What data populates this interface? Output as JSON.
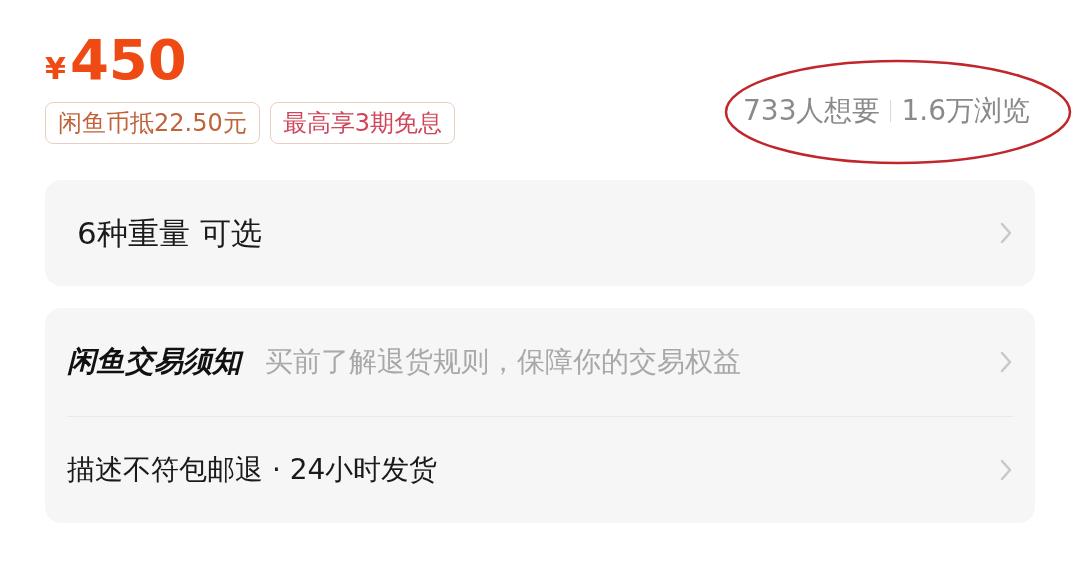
{
  "price": {
    "currency": "¥",
    "amount": "450"
  },
  "tags": [
    {
      "text": "闲鱼币抵22.50元",
      "color": "#c0623a"
    },
    {
      "text": "最高享3期免息",
      "color": "#d0455a"
    }
  ],
  "stats": {
    "wants": "733人想要",
    "views": "1.6万浏览",
    "circled": true
  },
  "spec_row": {
    "label": "6种重量 可选"
  },
  "notice_card": {
    "title": "闲鱼交易须知",
    "subtitle": "买前了解退货规则，保障你的交易权益",
    "shipping": "描述不符包邮退 · 24小时发货"
  }
}
